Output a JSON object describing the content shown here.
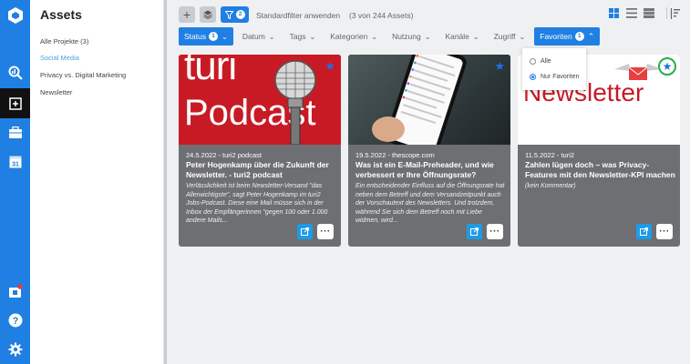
{
  "app": {
    "rail_icons": [
      "app-logo-icon",
      "search-stats-icon",
      "add-icon",
      "briefcase-icon",
      "calendar-icon",
      "notifications-icon",
      "help-icon",
      "settings-icon"
    ],
    "calendar_day": "31"
  },
  "sidebar": {
    "title": "Assets",
    "items": [
      {
        "label": "Alle Projekte (3)",
        "selected": false
      },
      {
        "label": "Social Media",
        "selected": true
      },
      {
        "label": "Privacy vs. Digital Marketing",
        "selected": false
      },
      {
        "label": "Newsletter",
        "selected": false
      }
    ]
  },
  "toolbar": {
    "add_symbol": "+",
    "filter_count": "2",
    "standard_filter_label": "Standardfilter anwenden",
    "asset_count": "(3 von 244 Assets)"
  },
  "filters": [
    {
      "label": "Status",
      "badge": "1",
      "active": true
    },
    {
      "label": "Datum",
      "badge": "",
      "active": false
    },
    {
      "label": "Tags",
      "badge": "",
      "active": false
    },
    {
      "label": "Kategorien",
      "badge": "",
      "active": false
    },
    {
      "label": "Nutzung",
      "badge": "",
      "active": false
    },
    {
      "label": "Kanäle",
      "badge": "",
      "active": false
    },
    {
      "label": "Zugriff",
      "badge": "",
      "active": false
    },
    {
      "label": "Favoriten",
      "badge": "1",
      "active": true,
      "open": true
    }
  ],
  "favorites_dropdown": {
    "options": [
      {
        "label": "Alle",
        "selected": false
      },
      {
        "label": "Nur Favoriten",
        "selected": true
      }
    ]
  },
  "cards": [
    {
      "thumb_text_top": "turi",
      "thumb_text_bottom": "Podcast",
      "meta": "24.5.2022 - turi2 podcast",
      "title": "Peter Hogenkamp über die Zukunft der Newsletter. - turi2 podcast",
      "description": "Verlässlichkeit ist beim Newsletter-Versand \"das Allerwichtigste\", sagt Peter Hogenkamp im turi2 Jobs-Podcast. Diese eine Mail müsse sich in der Inbox der Empfängerinnen \"gegen 100 oder 1.000 andere Mails...",
      "favorite": true
    },
    {
      "meta": "19.5.2022 - thescope.com",
      "title": "Was ist ein E-Mail-Preheader, und wie verbessert er Ihre Öffnungsrate?",
      "description": "Ein entscheidender Einfluss auf die Öffnungsrate hat neben dem Betreff und dem Versandzeitpunkt auch der Vorschautext des Newsletters. Und trotzdem, während Sie sich dem Betreff noch mit Liebe widmen, wird...",
      "favorite": true
    },
    {
      "thumb_text_top": "sen",
      "thumb_text_bottom": "Newsletter",
      "meta": "11.5.2022 - turi2",
      "title": "Zahlen lügen doch – was Privacy-Features mit den Newsletter-KPI machen",
      "description": "(kein Kommentar)",
      "favorite": true
    }
  ],
  "colors": {
    "brand_blue": "#1f7fe3",
    "card_bg": "#6e6f73",
    "star_highlight": "#23b04a",
    "podcast_red": "#c81a25"
  }
}
